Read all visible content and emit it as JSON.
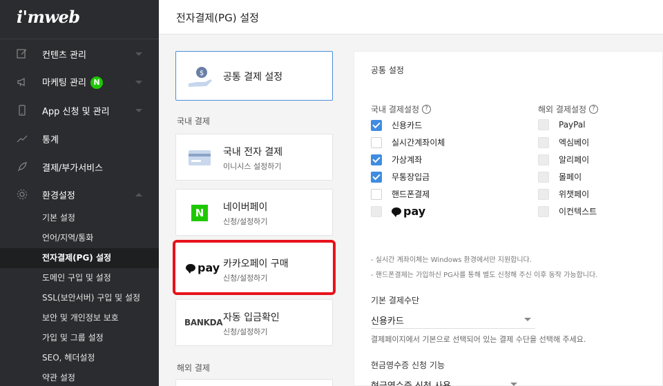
{
  "app": {
    "logo": "i'mweb",
    "page_title": "전자결제(PG) 설정"
  },
  "sidebar": {
    "items": [
      {
        "label": "컨텐츠 관리"
      },
      {
        "label": "마케팅 관리",
        "badge": "N"
      },
      {
        "label": "App 신청 및 관리"
      },
      {
        "label": "통계"
      },
      {
        "label": "결제/부가서비스"
      },
      {
        "label": "환경설정"
      }
    ],
    "sub_items": [
      {
        "label": "기본 설정"
      },
      {
        "label": "언어/지역/통화"
      },
      {
        "label": "전자결제(PG) 설정"
      },
      {
        "label": "도메인 구입 및 설정"
      },
      {
        "label": "SSL(보안서버) 구입 및 설정"
      },
      {
        "label": "보안 및 개인정보 보호"
      },
      {
        "label": "가입 및 그룹 설정"
      },
      {
        "label": "SEO, 헤더설정"
      },
      {
        "label": "약관 설정"
      }
    ]
  },
  "middle": {
    "common": {
      "title": "공통 결제 설정"
    },
    "domestic_label": "국내 결제",
    "overseas_label": "해외 결제",
    "cards": [
      {
        "title": "국내 전자 결제",
        "sub": "이니시스 설정하기"
      },
      {
        "title": "네이버페이",
        "sub": "신청/설정하기",
        "icon_text": "N"
      },
      {
        "title": "카카오페이 구매",
        "sub": "신청/설정하기",
        "icon_text": "pay"
      },
      {
        "title": "자동 입금확인",
        "sub": "신청/설정하기",
        "icon_text": "BANKDA"
      }
    ]
  },
  "panel": {
    "heading": "공통 설정",
    "domestic": {
      "title": "국내 결제설정",
      "items": [
        {
          "label": "신용카드",
          "checked": true
        },
        {
          "label": "실시간계좌이체",
          "checked": false
        },
        {
          "label": "가상계좌",
          "checked": true
        },
        {
          "label": "무통장입금",
          "checked": true
        },
        {
          "label": "핸드폰결제",
          "checked": false
        },
        {
          "label": "pay",
          "checked": false,
          "disabled": true
        }
      ]
    },
    "overseas": {
      "title": "해외 결제설정",
      "items": [
        {
          "label": "PayPal"
        },
        {
          "label": "엑심베이"
        },
        {
          "label": "알리페이"
        },
        {
          "label": "몰페이"
        },
        {
          "label": "위챗페이"
        },
        {
          "label": "이컨텍스트"
        }
      ]
    },
    "notes": [
      "- 실시간 계좌이체는 Windows 환경에서만 지원합니다.",
      "- 핸드폰결제는 가입하신 PG사를 통해 별도 신청해 주신 이후 동작 가능합니다."
    ],
    "default_method": {
      "label": "기본 결제수단",
      "value": "신용카드",
      "help": "결제페이지에서 기본으로 선택되어 있는 결제 수단을 선택해 주세요."
    },
    "receipt": {
      "label": "현금영수증 신청 기능",
      "value": "현금영수증 신청 사용"
    }
  },
  "colors": {
    "accent": "#3f8ce0",
    "highlight": "#e8121b",
    "naver": "#1ec800"
  }
}
